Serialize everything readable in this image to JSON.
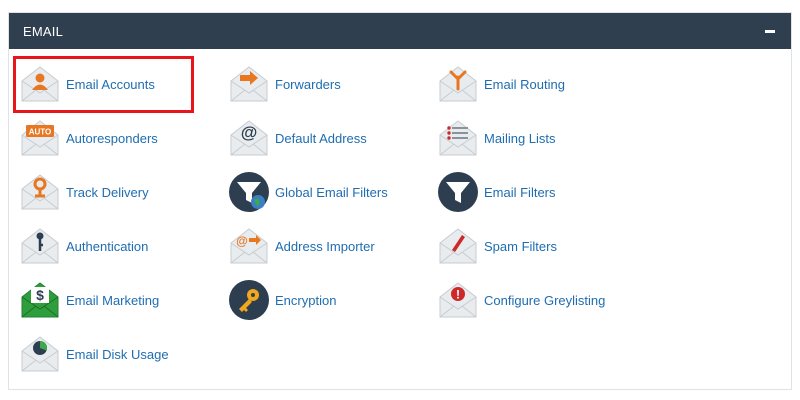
{
  "panel": {
    "title": "EMAIL",
    "collapse_icon": "minus-icon"
  },
  "colors": {
    "header_bg": "#2f3f4f",
    "link": "#1f6db0",
    "accent_orange": "#e87722",
    "highlight_border": "#e8161a",
    "filter_dark": "#2d3e50",
    "marketing_green": "#2e9e3d",
    "alert_red": "#cc2a2a"
  },
  "items": [
    {
      "label": "Email Accounts",
      "icon": "email-accounts-icon",
      "highlighted": true
    },
    {
      "label": "Forwarders",
      "icon": "forwarders-icon"
    },
    {
      "label": "Email Routing",
      "icon": "email-routing-icon"
    },
    {
      "label": "Autoresponders",
      "icon": "autoresponders-icon",
      "icon_text": "AUTO"
    },
    {
      "label": "Default Address",
      "icon": "default-address-icon",
      "icon_text": "@"
    },
    {
      "label": "Mailing Lists",
      "icon": "mailing-lists-icon"
    },
    {
      "label": "Track Delivery",
      "icon": "track-delivery-icon"
    },
    {
      "label": "Global Email Filters",
      "icon": "global-email-filters-icon"
    },
    {
      "label": "Email Filters",
      "icon": "email-filters-icon"
    },
    {
      "label": "Authentication",
      "icon": "authentication-icon"
    },
    {
      "label": "Address Importer",
      "icon": "address-importer-icon",
      "icon_text": "@"
    },
    {
      "label": "Spam Filters",
      "icon": "spam-filters-icon"
    },
    {
      "label": "Email Marketing",
      "icon": "email-marketing-icon",
      "icon_text": "$"
    },
    {
      "label": "Encryption",
      "icon": "encryption-icon"
    },
    {
      "label": "Configure Greylisting",
      "icon": "configure-greylisting-icon",
      "icon_text": "!"
    },
    {
      "label": "Email Disk Usage",
      "icon": "email-disk-usage-icon"
    }
  ]
}
